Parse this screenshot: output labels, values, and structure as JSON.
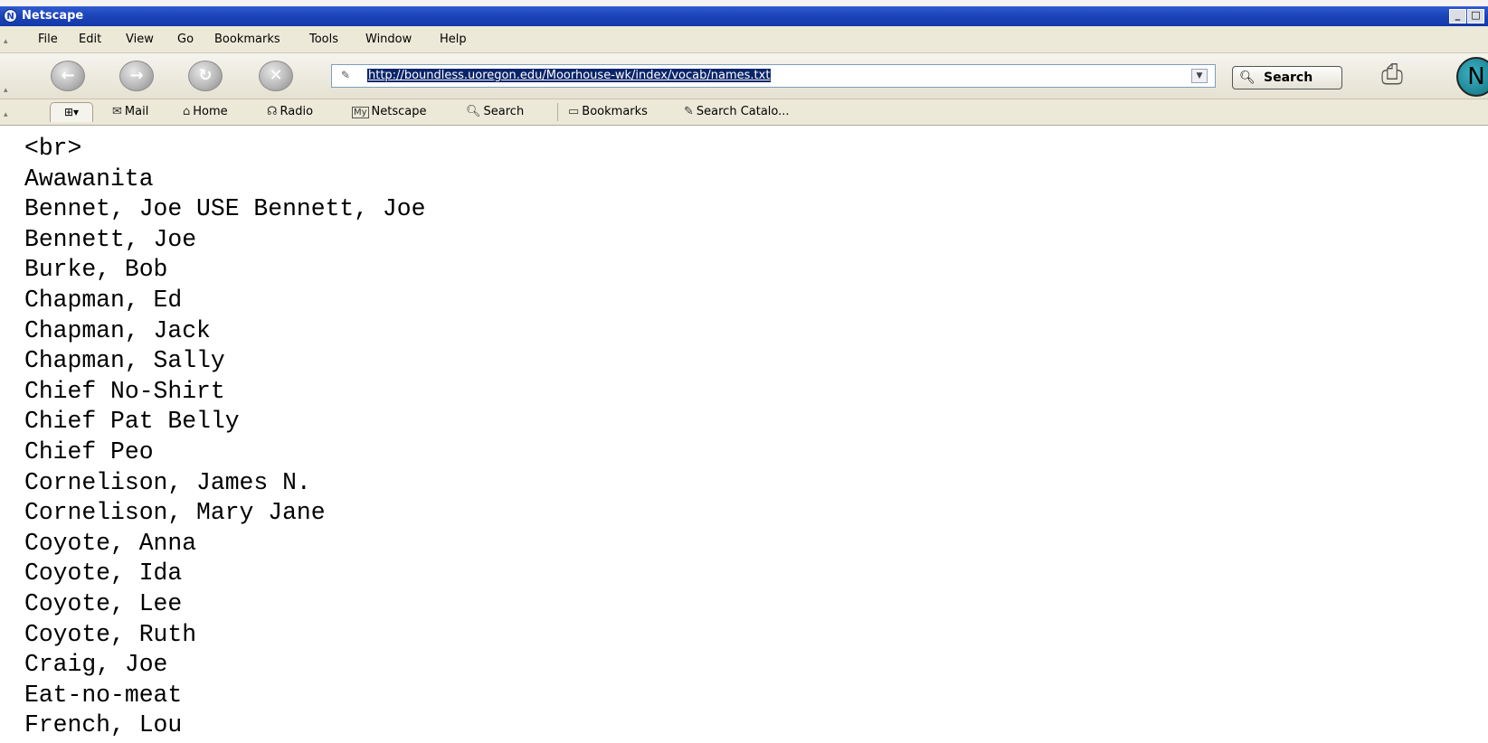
{
  "window": {
    "title": "Netscape",
    "logo_letter": "N",
    "minimize_glyph": "_",
    "maximize_glyph": "□"
  },
  "menu": {
    "items": [
      {
        "label": "File"
      },
      {
        "label": "Edit"
      },
      {
        "label": "View"
      },
      {
        "label": "Go"
      },
      {
        "label": "Bookmarks"
      },
      {
        "label": "Tools"
      },
      {
        "label": "Window"
      },
      {
        "label": "Help"
      }
    ]
  },
  "navigation": {
    "back_icon": "back-arrow-icon",
    "forward_icon": "forward-arrow-icon",
    "reload_icon": "reload-icon",
    "stop_icon": "stop-icon",
    "url": "http://boundless.uoregon.edu/Moorhouse-wk/index/vocab/names.txt",
    "search_label": "Search"
  },
  "personal_toolbar": {
    "items": [
      {
        "label": "Mail",
        "icon": "mail-icon"
      },
      {
        "label": "Home",
        "icon": "home-icon"
      },
      {
        "label": "Radio",
        "icon": "radio-icon"
      },
      {
        "label": "Netscape",
        "icon": "my-netscape-icon"
      },
      {
        "label": "Search",
        "icon": "search-icon"
      },
      {
        "label": "Bookmarks",
        "icon": "bookmarks-icon"
      },
      {
        "label": "Search Catalo...",
        "icon": "search-catalog-icon"
      }
    ]
  },
  "content": {
    "lines": [
      "<br>",
      "Awawanita",
      "Bennet, Joe USE Bennett, Joe",
      "Bennett, Joe",
      "Burke, Bob",
      "Chapman, Ed",
      "Chapman, Jack",
      "Chapman, Sally",
      "Chief No-Shirt",
      "Chief Pat Belly",
      "Chief Peo",
      "Cornelison, James N.",
      "Cornelison, Mary Jane",
      "Coyote, Anna",
      "Coyote, Ida",
      "Coyote, Lee",
      "Coyote, Ruth",
      "Craig, Joe",
      "Eat-no-meat",
      "French, Lou"
    ]
  },
  "colors": {
    "titlebar": "#1c43b8",
    "chrome": "#ece9d8",
    "url_selection": "#0a246a"
  }
}
